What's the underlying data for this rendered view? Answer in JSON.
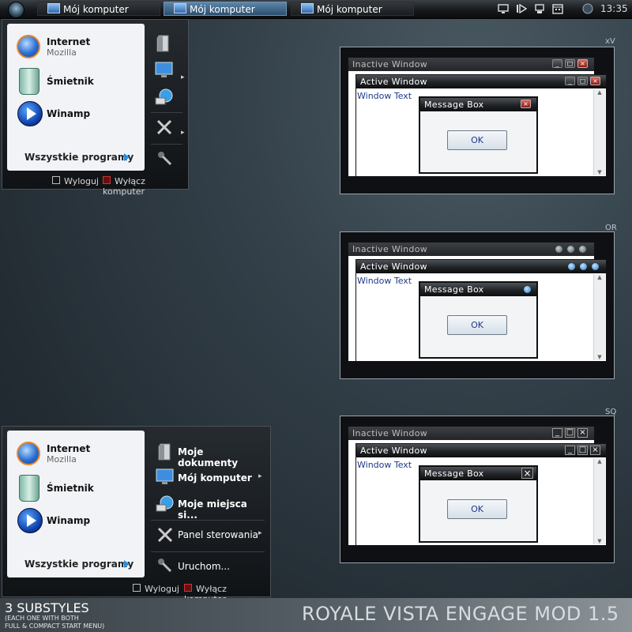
{
  "taskbar": {
    "buttons": [
      {
        "label": "Mój komputer",
        "active": false
      },
      {
        "label": "Mój komputer",
        "active": true
      },
      {
        "label": "Mój komputer",
        "active": false
      }
    ],
    "tray_icons": [
      "monitor-icon",
      "media-icon",
      "network-icon",
      "calendar-icon",
      "globe-icon"
    ],
    "clock": "13:35"
  },
  "compact_start_menu": {
    "pinned": [
      {
        "title": "Internet",
        "subtitle": "Mozilla",
        "icon": "firefox-icon"
      },
      {
        "title": "Śmietnik",
        "subtitle": "",
        "icon": "recycle-bin-icon"
      },
      {
        "title": "Winamp",
        "subtitle": "",
        "icon": "winamp-icon"
      }
    ],
    "all_programs": "Wszystkie programy",
    "right_icons": [
      "documents-icon",
      "computer-icon",
      "network-places-icon",
      "tools-icon",
      "run-icon"
    ],
    "logoff": "Wyloguj",
    "shutdown": "Wyłącz komputer"
  },
  "full_start_menu": {
    "pinned": [
      {
        "title": "Internet",
        "subtitle": "Mozilla",
        "icon": "firefox-icon"
      },
      {
        "title": "Śmietnik",
        "subtitle": "",
        "icon": "recycle-bin-icon"
      },
      {
        "title": "Winamp",
        "subtitle": "",
        "icon": "winamp-icon"
      }
    ],
    "all_programs": "Wszystkie programy",
    "right_items": [
      {
        "label": "Moje dokumenty",
        "bold": true,
        "arrow": false
      },
      {
        "label": "Mój komputer",
        "bold": true,
        "arrow": true
      },
      {
        "label": "Moje miejsca si...",
        "bold": true,
        "arrow": false
      },
      {
        "label": "Panel sterowania",
        "bold": false,
        "arrow": true
      },
      {
        "label": "Uruchom...",
        "bold": false,
        "arrow": false
      }
    ],
    "logoff": "Wyloguj",
    "shutdown": "Wyłącz komputer"
  },
  "previews": [
    {
      "label": "xV",
      "style": "xp-buttons",
      "inactive_title": "Inactive Window",
      "active_title": "Active Window",
      "window_text": "Window Text",
      "message_title": "Message Box",
      "ok": "OK"
    },
    {
      "label": "OR",
      "style": "orb-buttons",
      "inactive_title": "Inactive Window",
      "active_title": "Active Window",
      "window_text": "Window Text",
      "message_title": "Message Box",
      "ok": "OK"
    },
    {
      "label": "SQ",
      "style": "square-buttons",
      "inactive_title": "Inactive Window",
      "active_title": "Active Window",
      "window_text": "Window Text",
      "message_title": "Message Box",
      "ok": "OK"
    }
  ],
  "footer": {
    "subtitle": "3 SUBSTYLES",
    "note_line1": "(EACH ONE WITH BOTH",
    "note_line2": "FULL & COMPACT START MENU)",
    "title": "ROYALE VISTA ENGAGE MOD 1.5"
  },
  "colors": {
    "accent": "#2a8ee0",
    "link_text": "#1e3a8a",
    "close_red": "#b8382d"
  }
}
